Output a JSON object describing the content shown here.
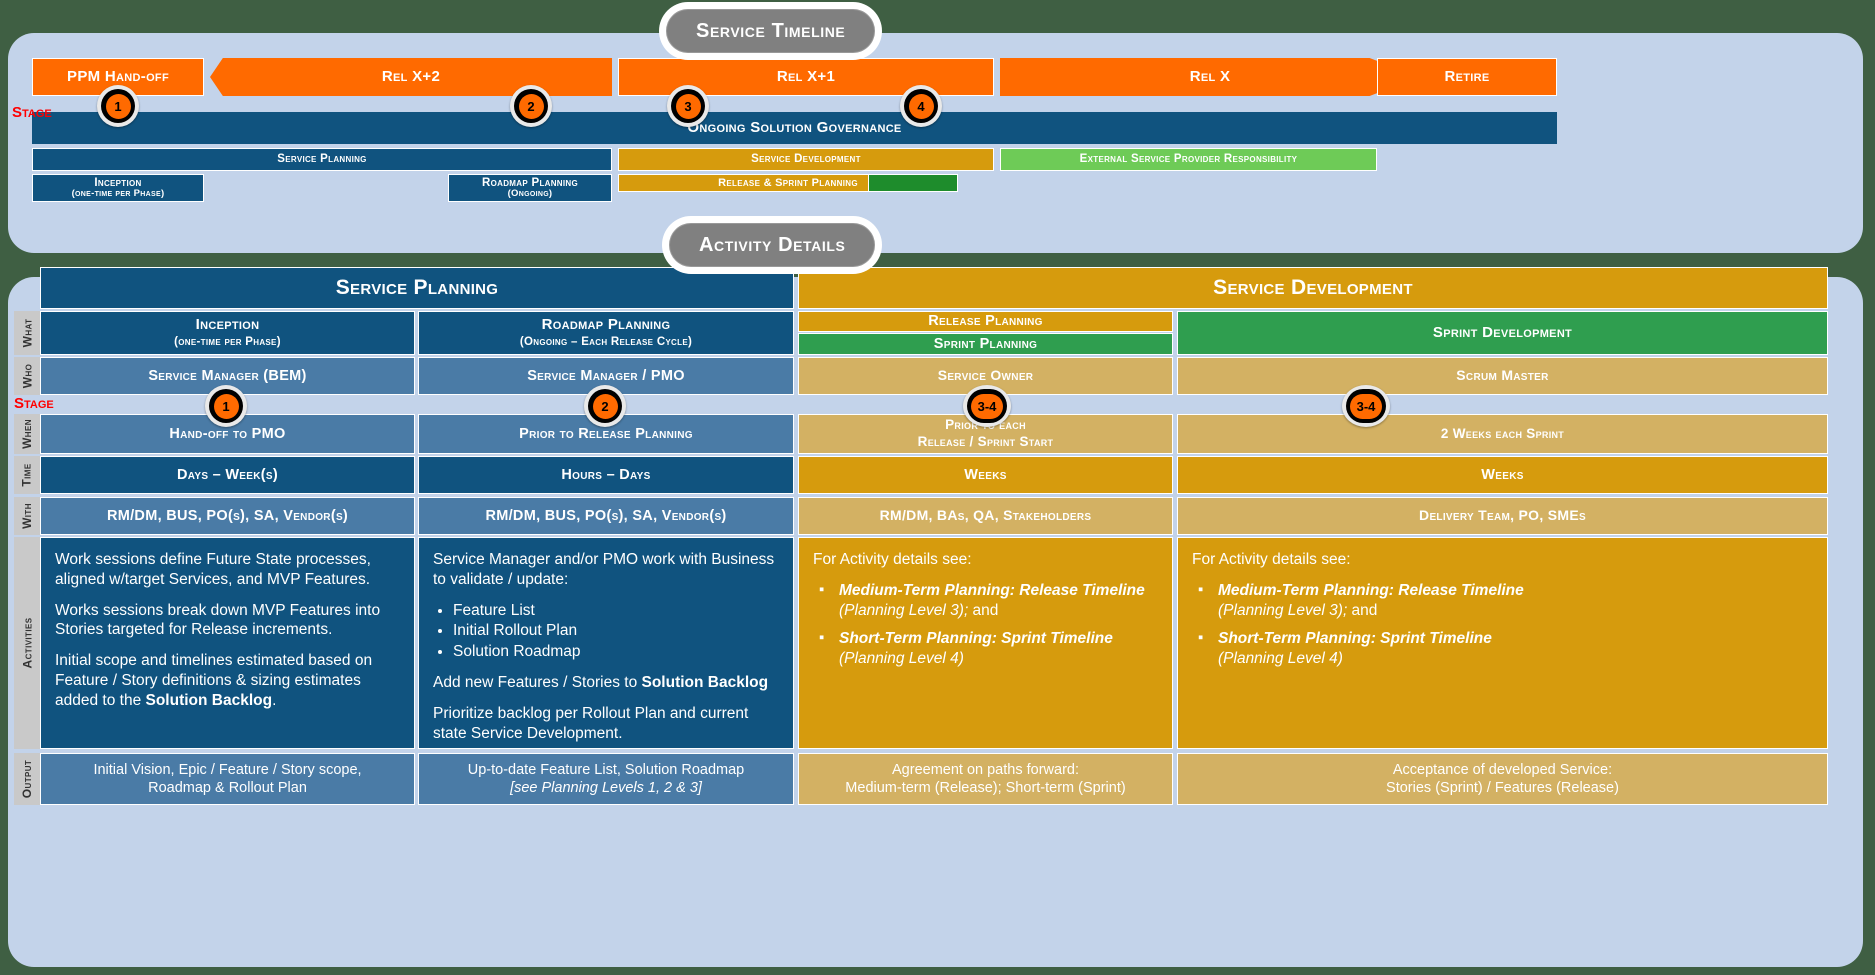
{
  "headers": {
    "timeline": "Service Timeline",
    "details": "Activity Details"
  },
  "stage_label": "Stage",
  "colors": {
    "orange": "#ff6a00",
    "dark_blue": "#10537f",
    "mid_blue": "#4a7ba6",
    "gold": "#d69b0d",
    "light_gold": "#d3b163",
    "green": "#2f9e4f",
    "light_green": "#6ecb57",
    "dark_green": "#1e8c2c",
    "panel": "#c3d3ea",
    "background": "#3f5f43",
    "badge_label": "#ff0000"
  },
  "timeline": {
    "releases": [
      {
        "label": "PPM Hand-off"
      },
      {
        "label": "Rel X+2"
      },
      {
        "label": "Rel X+1"
      },
      {
        "label": "Rel X"
      },
      {
        "label": "Retire"
      }
    ],
    "governance": "Ongoing Solution Governance",
    "tracks": [
      {
        "label": "Service Planning"
      },
      {
        "label": "Service Development"
      },
      {
        "label": "External Service Provider Responsibility"
      }
    ],
    "subtracks": [
      {
        "label": "Inception",
        "sub": "(one-time per Phase)"
      },
      {
        "label": "Roadmap Planning",
        "sub": "(Ongoing)"
      },
      {
        "label": "Release & Sprint Planning",
        "sub": ""
      }
    ],
    "badges": [
      "1",
      "2",
      "3",
      "4"
    ]
  },
  "details": {
    "groups": [
      {
        "label": "Service Planning"
      },
      {
        "label": "Service Development"
      }
    ],
    "row_labels": [
      "What",
      "Who",
      "When",
      "Time",
      "With",
      "Activities",
      "Output"
    ],
    "badges": [
      "1",
      "2",
      "3-4",
      "3-4"
    ],
    "columns": [
      {
        "what": "Inception",
        "what_sub": "(one-time per Phase)",
        "who": "Service Manager (BEM)",
        "when": "Hand-off to PMO",
        "when_sub": "",
        "time": "Days – Week(s)",
        "with": "RM/DM, BUS, PO(s), SA, Vendor(s)",
        "output_line1": "Initial Vision, Epic / Feature / Story scope,",
        "output_line2": "Roadmap & Rollout Plan"
      },
      {
        "what": "Roadmap Planning",
        "what_sub": "(Ongoing – Each Release Cycle)",
        "who": "Service Manager / PMO",
        "when": "Prior to Release Planning",
        "when_sub": "",
        "time": "Hours – Days",
        "with": "RM/DM, BUS, PO(s), SA, Vendor(s)",
        "output_line1": "Up-to-date Feature List, Solution Roadmap",
        "output_line2": "[see Planning Levels 1, 2 & 3]"
      },
      {
        "what": "Release Planning",
        "what_sub": "Sprint Planning",
        "who": "Service Owner",
        "when": "Prior to each",
        "when_sub": "Release / Sprint Start",
        "time": "Weeks",
        "with": "RM/DM, BAs, QA, Stakeholders",
        "output_line1": "Agreement on paths forward:",
        "output_line2": "Medium-term (Release); Short-term (Sprint)"
      },
      {
        "what": "Sprint Development",
        "what_sub": "",
        "who": "Scrum Master",
        "when": "2 Weeks each Sprint",
        "when_sub": "",
        "time": "Weeks",
        "with": "Delivery Team, PO, SMEs",
        "output_line1": "Acceptance of developed Service:",
        "output_line2": "Stories (Sprint) / Features (Release)"
      }
    ],
    "activities": {
      "col1": {
        "p1": "Work sessions define Future State processes, aligned w/target Services, and MVP Features.",
        "p2": "Works sessions break down MVP Features into Stories targeted for Release increments.",
        "p3_a": "Initial scope and timelines estimated based on Feature / Story definitions & sizing estimates added to the ",
        "p3_b": "Solution Backlog",
        "p3_c": "."
      },
      "col2": {
        "p1": "Service Manager and/or PMO work with Business to validate / update:",
        "bullets": [
          "Feature List",
          "Initial Rollout Plan",
          "Solution Roadmap"
        ],
        "p2_a": "Add new Features / Stories to ",
        "p2_b": "Solution Backlog",
        "p3": "Prioritize backlog per Rollout Plan and current state Service Development."
      },
      "col3": {
        "intro": "For Activity details see:",
        "items": [
          {
            "bold": "Medium-Term Planning: Release Timeline",
            "tail_it": "(Planning Level 3);",
            "tail": " and"
          },
          {
            "bold": "Short-Term Planning: Sprint Timeline",
            "tail_it": " (Planning Level 4)",
            "tail": ""
          }
        ]
      },
      "col4": {
        "intro": "For Activity details see:",
        "items": [
          {
            "bold": "Medium-Term Planning: Release Timeline",
            "tail_it": "(Planning Level 3);",
            "tail": " and"
          },
          {
            "bold": "Short-Term Planning: Sprint Timeline",
            "tail_it": " (Planning Level 4)",
            "tail": ""
          }
        ]
      }
    }
  }
}
